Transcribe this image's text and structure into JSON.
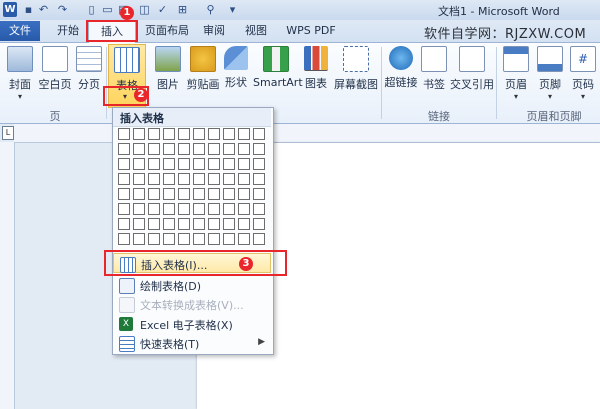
{
  "window": {
    "title": "文档1 - Microsoft Word",
    "watermark": "软件自学网：RJZXW.COM"
  },
  "quick_access": [
    "save-icon",
    "undo-icon",
    "redo-icon",
    "new-icon",
    "open-icon",
    "print-icon",
    "preview-icon",
    "spell-icon",
    "format-icon",
    "tree-icon",
    "more-icon"
  ],
  "tabs": [
    "文件",
    "开始",
    "插入",
    "页面布局",
    "审阅",
    "视图",
    "WPS PDF"
  ],
  "ribbon": {
    "groups": [
      {
        "name": "页",
        "items": [
          "封面",
          "空白页",
          "分页"
        ]
      },
      {
        "name": "",
        "items": [
          "表格"
        ]
      },
      {
        "name": "",
        "items": [
          "图片",
          "剪贴画",
          "形状",
          "SmartArt",
          "图表",
          "屏幕截图"
        ]
      },
      {
        "name": "链接",
        "items": [
          "超链接",
          "书签",
          "交叉引用"
        ]
      },
      {
        "name": "页眉和页脚",
        "items": [
          "页眉",
          "页脚",
          "页码"
        ]
      }
    ]
  },
  "menu": {
    "header": "插入表格",
    "grid": {
      "rows": 8,
      "cols": 10
    },
    "items": [
      {
        "label": "插入表格(I)...",
        "state": "highlighted"
      },
      {
        "label": "绘制表格(D)",
        "state": "normal"
      },
      {
        "label": "文本转换成表格(V)...",
        "state": "disabled"
      },
      {
        "label": "Excel 电子表格(X)",
        "state": "normal"
      },
      {
        "label": "快速表格(T)",
        "state": "normal",
        "submenu": true
      }
    ]
  },
  "annotations": {
    "step1": "1",
    "step2": "2",
    "step3": "3"
  },
  "colors": {
    "highlight": "#e8262b",
    "file_tab": "#2b5ca8",
    "ribbon_bg": "#eaf1fa"
  }
}
